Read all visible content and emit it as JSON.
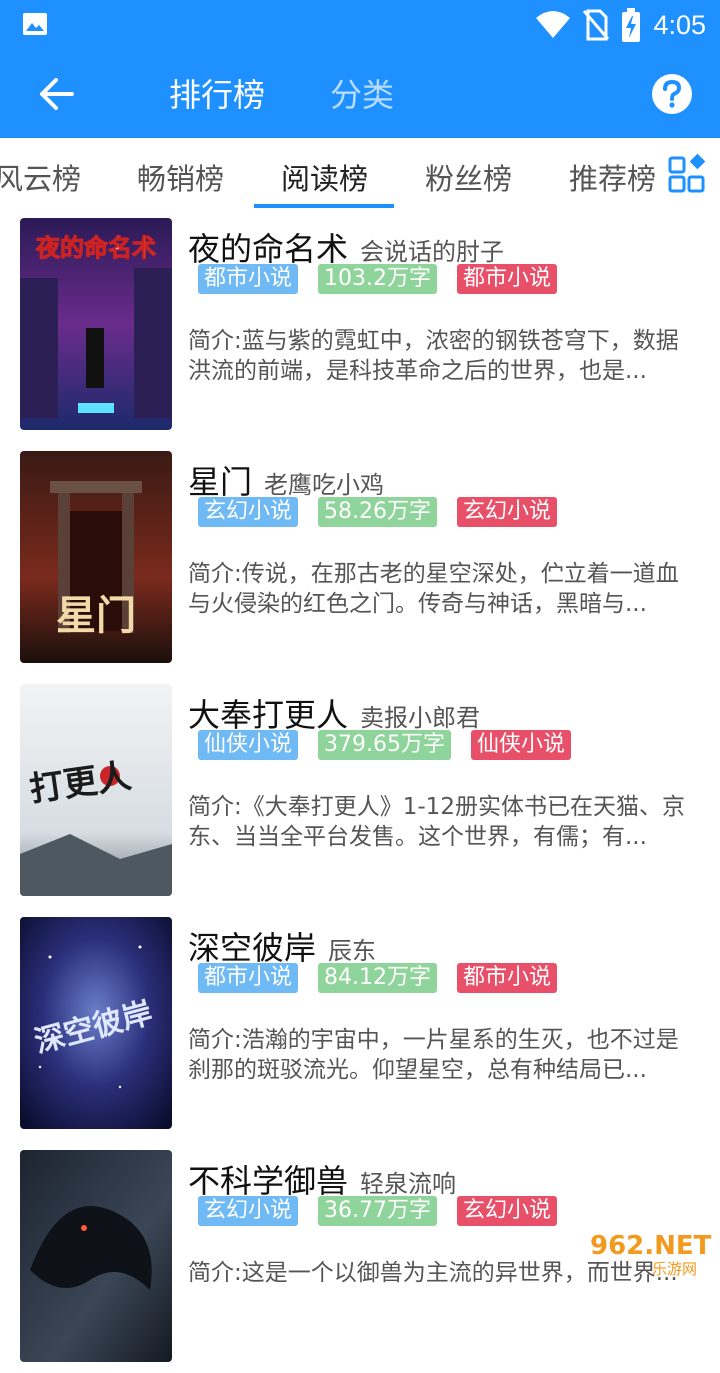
{
  "status": {
    "time": "4:05"
  },
  "toolbar": {
    "tabs": [
      {
        "label": "排行榜"
      },
      {
        "label": "分类"
      }
    ]
  },
  "rank_tabs": [
    {
      "label": "风云榜"
    },
    {
      "label": "畅销榜"
    },
    {
      "label": "阅读榜"
    },
    {
      "label": "粉丝榜"
    },
    {
      "label": "推荐榜"
    }
  ],
  "books": [
    {
      "title": "夜的命名术",
      "author": "会说话的肘子",
      "tags": [
        "都市小说",
        "103.2万字",
        "都市小说"
      ],
      "desc": "简介:蓝与紫的霓虹中，浓密的钢铁苍穹下，数据洪流的前端，是科技革命之后的世界，也是...",
      "cover_text": "夜的命名术"
    },
    {
      "title": "星门",
      "author": "老鹰吃小鸡",
      "tags": [
        "玄幻小说",
        "58.26万字",
        "玄幻小说"
      ],
      "desc": "简介:传说，在那古老的星空深处，伫立着一道血与火侵染的红色之门。传奇与神话，黑暗与...",
      "cover_text": "星门"
    },
    {
      "title": "大奉打更人",
      "author": "卖报小郎君",
      "tags": [
        "仙侠小说",
        "379.65万字",
        "仙侠小说"
      ],
      "desc": "简介:《大奉打更人》1-12册实体书已在天猫、京东、当当全平台发售。这个世界，有儒；有...",
      "cover_text": "打更人"
    },
    {
      "title": "深空彼岸",
      "author": "辰东",
      "tags": [
        "都市小说",
        "84.12万字",
        "都市小说"
      ],
      "desc": "简介:浩瀚的宇宙中，一片星系的生灭，也不过是刹那的斑驳流光。仰望星空，总有种结局已...",
      "cover_text": "深空彼岸"
    },
    {
      "title": "不科学御兽",
      "author": "轻泉流响",
      "tags": [
        "玄幻小说",
        "36.77万字",
        "玄幻小说"
      ],
      "desc": "简介:这是一个以御兽为主流的异世界，而世界...",
      "cover_text": ""
    }
  ],
  "watermark": {
    "line1": "962.NET",
    "line2": "乐游网"
  },
  "colors": {
    "primary": "#1e90ff",
    "tag_blue": "#6fb9f5",
    "tag_green": "#8fd49a",
    "tag_red": "#e8506a"
  }
}
